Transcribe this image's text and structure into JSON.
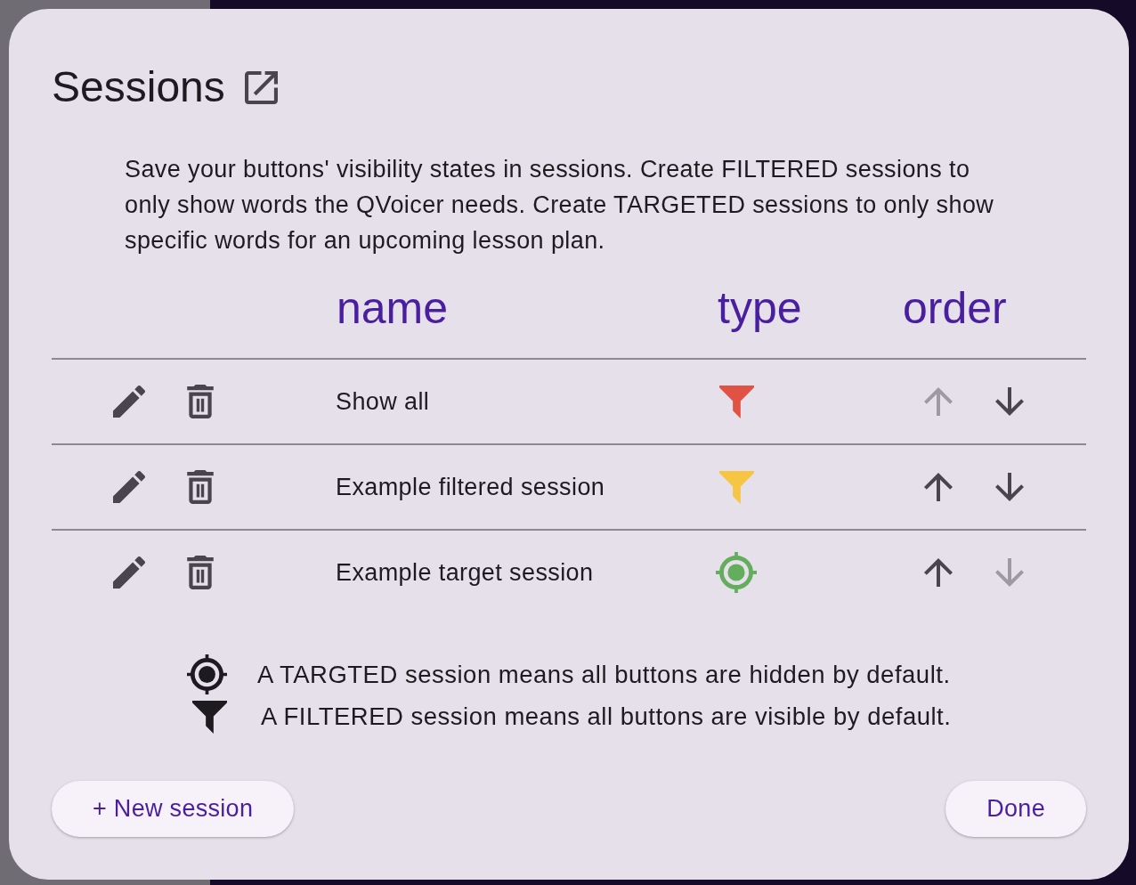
{
  "dialog": {
    "title": "Sessions",
    "description": "Save your buttons' visibility states in sessions. Create FILTERED sessions to only show words the QVoicer needs. Create TARGETED sessions to only show specific words for an upcoming lesson plan."
  },
  "table": {
    "columns": [
      "name",
      "type",
      "order"
    ],
    "rows": [
      {
        "name": "Show all",
        "kind": "filter",
        "color": "#e05243",
        "up_disabled": true,
        "down_disabled": false
      },
      {
        "name": "Example filtered session",
        "kind": "filter",
        "color": "#f6c544",
        "up_disabled": false,
        "down_disabled": false
      },
      {
        "name": "Example target session",
        "kind": "target",
        "color": "#63ad5d",
        "up_disabled": false,
        "down_disabled": true
      }
    ]
  },
  "legend": [
    {
      "kind": "target",
      "text": "A TARGTED session means all buttons are hidden by default."
    },
    {
      "kind": "filter",
      "text": "A FILTERED session means all buttons are visible by default."
    }
  ],
  "actions": {
    "new_session": "+ New session",
    "done": "Done"
  }
}
